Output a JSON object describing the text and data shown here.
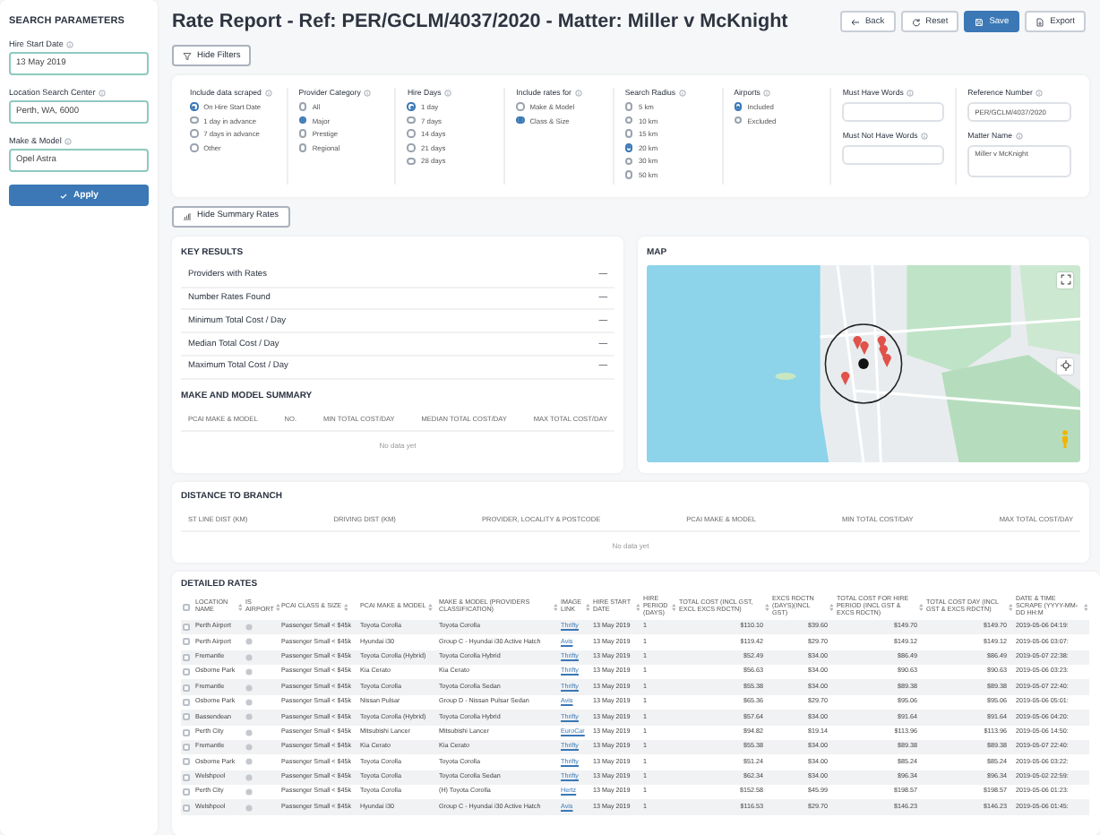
{
  "sidebar": {
    "title": "SEARCH PARAMETERS",
    "fields": [
      {
        "label": "Hire Start Date",
        "value": "13 May 2019"
      },
      {
        "label": "Location Search Center",
        "value": "Perth, WA, 6000"
      },
      {
        "label": "Make & Model",
        "value": "Opel Astra"
      }
    ],
    "apply_button": "Apply"
  },
  "header": {
    "title": "Rate Report - Ref: PER/GCLM/4037/2020 - Matter: Miller v McKnight",
    "buttons": [
      {
        "kind": "back",
        "label": "Back",
        "primary": false
      },
      {
        "kind": "reset",
        "label": "Reset",
        "primary": false
      },
      {
        "kind": "save",
        "label": "Save",
        "primary": true
      },
      {
        "kind": "export",
        "label": "Export",
        "primary": false
      }
    ]
  },
  "filters": {
    "toggle_button": "Hide Filters",
    "groups": [
      {
        "label": "Include data scraped",
        "options": [
          {
            "label": "On Hire Start Date",
            "selected": true
          },
          {
            "label": "1 day in advance",
            "selected": false
          },
          {
            "label": "7 days in advance",
            "selected": false
          },
          {
            "label": "Other",
            "selected": false
          }
        ]
      },
      {
        "label": "Provider Category",
        "options": [
          {
            "label": "All",
            "selected": false
          },
          {
            "label": "Major",
            "selected": true
          },
          {
            "label": "Prestige",
            "selected": false
          },
          {
            "label": "Regional",
            "selected": false
          }
        ]
      },
      {
        "label": "Hire Days",
        "options": [
          {
            "label": "1 day",
            "selected": true
          },
          {
            "label": "7 days",
            "selected": false
          },
          {
            "label": "14 days",
            "selected": false
          },
          {
            "label": "21 days",
            "selected": false
          },
          {
            "label": "28 days",
            "selected": false
          }
        ]
      },
      {
        "label": "Include rates for",
        "options": [
          {
            "label": "Make & Model",
            "selected": false
          },
          {
            "label": "Class & Size",
            "selected": true
          }
        ]
      },
      {
        "label": "Search Radius",
        "options": [
          {
            "label": "5 km",
            "selected": false
          },
          {
            "label": "10 km",
            "selected": false
          },
          {
            "label": "15 km",
            "selected": false
          },
          {
            "label": "20 km",
            "selected": true
          },
          {
            "label": "30 km",
            "selected": false
          },
          {
            "label": "50 km",
            "selected": false
          }
        ]
      },
      {
        "label": "Airports",
        "options": [
          {
            "label": "Included",
            "selected": true
          },
          {
            "label": "Excluded",
            "selected": false
          }
        ]
      }
    ],
    "field_columns": [
      [
        {
          "label": "Must Have Words"
        },
        {
          "label": "Must Not Have Words"
        }
      ],
      [
        {
          "label": "Reference Number",
          "value": "PER/GCLM/4037/2020"
        },
        {
          "label": "Matter Name",
          "value": "Miller v McKnight",
          "kind": "textarea"
        }
      ]
    ]
  },
  "summary_toggle": "Hide Summary Rates",
  "key_results": {
    "title": "KEY RESULTS",
    "items": [
      {
        "label": "Providers with Rates",
        "value": "—"
      },
      {
        "label": "Number Rates Found",
        "value": "—"
      },
      {
        "label": "Minimum Total Cost / Day",
        "value": "—"
      },
      {
        "label": "Median Total Cost / Day",
        "value": "—"
      },
      {
        "label": "Maximum Total Cost / Day",
        "value": "—"
      }
    ]
  },
  "make_model_summary": {
    "title": "MAKE AND MODEL SUMMARY",
    "columns": [
      "PCAI MAKE & MODEL",
      "NO.",
      "MIN TOTAL COST/DAY",
      "MEDIAN TOTAL COST/DAY",
      "MAX TOTAL COST/DAY"
    ],
    "empty": "No data yet"
  },
  "map": {
    "title": "MAP",
    "kind": "picture"
  },
  "distance": {
    "title": "DISTANCE TO BRANCH",
    "columns": [
      "ST LINE DIST (KM)",
      "DRIVING DIST (KM)",
      "PROVIDER, LOCALITY & POSTCODE",
      "PCAI MAKE & MODEL",
      "MIN TOTAL COST/DAY",
      "MAX TOTAL COST/DAY"
    ],
    "empty": "No data yet"
  },
  "detailed_rates": {
    "title": "DETAILED RATES",
    "header_checked": false,
    "columns": [
      "LOCATION NAME",
      "IS AIRPORT",
      "PCAI CLASS & SIZE",
      "PCAI MAKE & MODEL",
      "MAKE & MODEL (PROVIDERS CLASSIFICATION)",
      "IMAGE LINK",
      "HIRE START DATE",
      "HIRE PERIOD (DAYS)",
      "TOTAL COST (INCL GST, EXCL EXCS RDCTN)",
      "EXCS RDCTN (DAYS)(INCL GST)",
      "TOTAL COST FOR HIRE PERIOD (INCL GST & EXCS RDCTN)",
      "TOTAL COST DAY (INCL GST & EXCS RDCTN)",
      "DATE & TIME SCRAPE (YYYY-MM-DD HH:M"
    ],
    "rows": [
      {
        "checked": false,
        "cells": [
          "Perth Airport",
          "",
          "Passenger Small < $45k",
          "Toyota Corolla",
          "Toyota Corolla",
          "Thrifty",
          "13 May 2019",
          "1",
          "$110.10",
          "$39.60",
          "$149.70",
          "$149.70",
          "2019-05-06 04:19:"
        ]
      },
      {
        "checked": false,
        "cells": [
          "Perth Airport",
          "",
          "Passenger Small < $45k",
          "Hyundai i30",
          "Group C - Hyundai i30 Active Hatch",
          "Avis",
          "13 May 2019",
          "1",
          "$119.42",
          "$29.70",
          "$149.12",
          "$149.12",
          "2019-05-06 03:07:"
        ]
      },
      {
        "checked": false,
        "cells": [
          "Fremantle",
          "",
          "Passenger Small < $45k",
          "Toyota Corolla (Hybrid)",
          "Toyota Corolla Hybrid",
          "Thrifty",
          "13 May 2019",
          "1",
          "$52.49",
          "$34.00",
          "$86.49",
          "$86.49",
          "2019-05-07 22:38:"
        ]
      },
      {
        "checked": false,
        "cells": [
          "Osborne Park",
          "",
          "Passenger Small < $45k",
          "Kia Cerato",
          "Kia Cerato",
          "Thrifty",
          "13 May 2019",
          "1",
          "$56.63",
          "$34.00",
          "$90.63",
          "$90.63",
          "2019-05-06 03:23:"
        ]
      },
      {
        "checked": false,
        "cells": [
          "Fremantle",
          "",
          "Passenger Small < $45k",
          "Toyota Corolla",
          "Toyota Corolla Sedan",
          "Thrifty",
          "13 May 2019",
          "1",
          "$55.38",
          "$34.00",
          "$89.38",
          "$89.38",
          "2019-05-07 22:40:"
        ]
      },
      {
        "checked": false,
        "cells": [
          "Osborne Park",
          "",
          "Passenger Small < $45k",
          "Nissan Pulsar",
          "Group D - Nissan Pulsar Sedan",
          "Avis",
          "13 May 2019",
          "1",
          "$65.36",
          "$29.70",
          "$95.06",
          "$95.06",
          "2019-05-06 05:01:"
        ]
      },
      {
        "checked": false,
        "cells": [
          "Bassendean",
          "",
          "Passenger Small < $45k",
          "Toyota Corolla (Hybrid)",
          "Toyota Corolla Hybrid",
          "Thrifty",
          "13 May 2019",
          "1",
          "$57.64",
          "$34.00",
          "$91.64",
          "$91.64",
          "2019-05-06 04:20:"
        ]
      },
      {
        "checked": false,
        "cells": [
          "Perth City",
          "",
          "Passenger Small < $45k",
          "Mitsubishi Lancer",
          "Mitsubishi Lancer",
          "EuroCar",
          "13 May 2019",
          "1",
          "$94.82",
          "$19.14",
          "$113.96",
          "$113.96",
          "2019-05-06 14:50:"
        ]
      },
      {
        "checked": false,
        "cells": [
          "Fremantle",
          "",
          "Passenger Small < $45k",
          "Kia Cerato",
          "Kia Cerato",
          "Thrifty",
          "13 May 2019",
          "1",
          "$55.38",
          "$34.00",
          "$89.38",
          "$89.38",
          "2019-05-07 22:40:"
        ]
      },
      {
        "checked": false,
        "cells": [
          "Osborne Park",
          "",
          "Passenger Small < $45k",
          "Toyota Corolla",
          "Toyota Corolla",
          "Thrifty",
          "13 May 2019",
          "1",
          "$51.24",
          "$34.00",
          "$85.24",
          "$85.24",
          "2019-05-06 03:22:"
        ]
      },
      {
        "checked": false,
        "cells": [
          "Welshpool",
          "",
          "Passenger Small < $45k",
          "Toyota Corolla",
          "Toyota Corolla Sedan",
          "Thrifty",
          "13 May 2019",
          "1",
          "$62.34",
          "$34.00",
          "$96.34",
          "$96.34",
          "2019-05-02 22:59:"
        ]
      },
      {
        "checked": false,
        "cells": [
          "Perth City",
          "",
          "Passenger Small < $45k",
          "Toyota Corolla",
          "(H) Toyota Corolla",
          "Hertz",
          "13 May 2019",
          "1",
          "$152.58",
          "$45.99",
          "$198.57",
          "$198.57",
          "2019-05-06 01:23:"
        ]
      },
      {
        "checked": false,
        "cells": [
          "Welshpool",
          "",
          "Passenger Small < $45k",
          "Hyundai i30",
          "Group C - Hyundai i30 Active Hatch",
          "Avis",
          "13 May 2019",
          "1",
          "$116.53",
          "$29.70",
          "$146.23",
          "$146.23",
          "2019-05-06 01:45:"
        ]
      }
    ]
  }
}
